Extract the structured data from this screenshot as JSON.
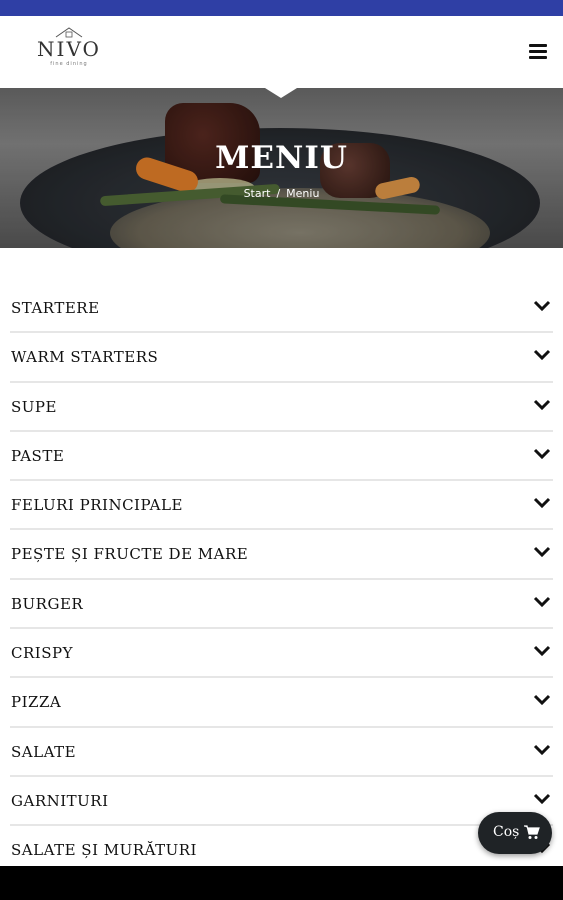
{
  "header": {
    "logo_text": "NIVO",
    "logo_subtext": "fine dining",
    "menu_icon": "hamburger-icon"
  },
  "hero": {
    "title": "MENIU",
    "breadcrumb": {
      "home": "Start",
      "separator": "/",
      "current": "Meniu"
    }
  },
  "categories": [
    {
      "label": "STARTERE"
    },
    {
      "label": "WARM STARTERS"
    },
    {
      "label": "SUPE"
    },
    {
      "label": "PASTE"
    },
    {
      "label": "FELURI PRINCIPALE"
    },
    {
      "label": "PEȘTE ȘI FRUCTE DE MARE"
    },
    {
      "label": "BURGER"
    },
    {
      "label": "CRISPY"
    },
    {
      "label": "PIZZA"
    },
    {
      "label": "SALATE"
    },
    {
      "label": "GARNITURI"
    },
    {
      "label": "SALATE ȘI MURĂTURI"
    }
  ],
  "cart": {
    "label": "Coș",
    "icon": "shopping-cart-icon"
  },
  "colors": {
    "status_bar": "#2f3fa5",
    "text": "#111111",
    "divider": "#e6e6e6",
    "cart_bg": "#1f2326"
  }
}
